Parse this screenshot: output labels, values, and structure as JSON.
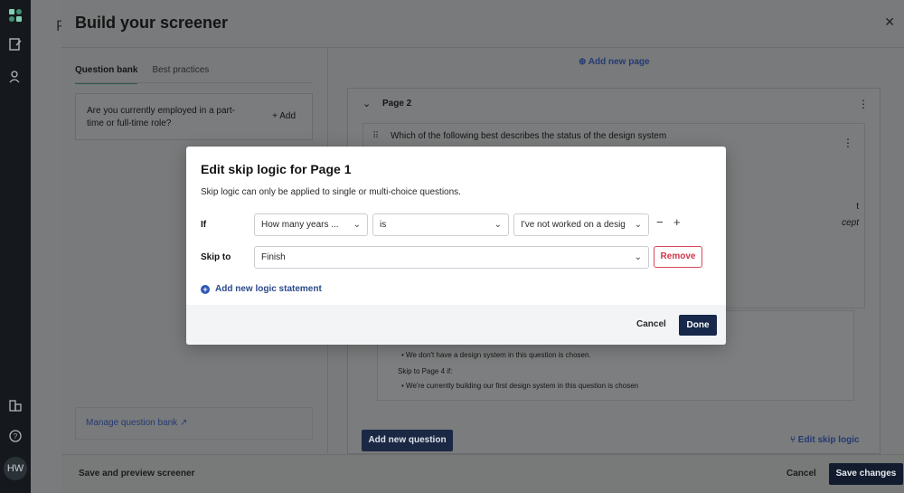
{
  "rail": {
    "avatar": "HW"
  },
  "background": {
    "partial_title": "P"
  },
  "sheet": {
    "title": "Build your screener",
    "tabs": [
      "Question bank",
      "Best practices"
    ],
    "question_card": {
      "text": "Are you currently employed in a part-time or full-time role?",
      "add": "+ Add"
    },
    "manage_bank": "Manage question bank",
    "add_new_page": "Add new page",
    "page": {
      "title": "Page 2",
      "question": "Which of the following best describes the status of the design system",
      "partial_right_1": "t",
      "partial_right_2": "cept",
      "logic_lines": [
        "We don't have a design system in this question is chosen.",
        "Skip to Page 4 if:",
        "We're currently building our first design system in this question is chosen"
      ]
    },
    "add_question": "Add new question",
    "edit_skip_logic": "Edit skip logic"
  },
  "footer": {
    "preview": "Save and preview screener",
    "cancel": "Cancel",
    "save": "Save changes"
  },
  "modal": {
    "title": "Edit skip logic for Page 1",
    "description": "Skip logic can only be applied to single or multi-choice questions.",
    "if_label": "If",
    "skip_label": "Skip to",
    "if_question": "How many years ...",
    "operator": "is",
    "answer": "I've not worked on a desig",
    "skip_target": "Finish",
    "remove": "Remove",
    "add_logic": "Add new logic statement",
    "cancel": "Cancel",
    "done": "Done"
  }
}
